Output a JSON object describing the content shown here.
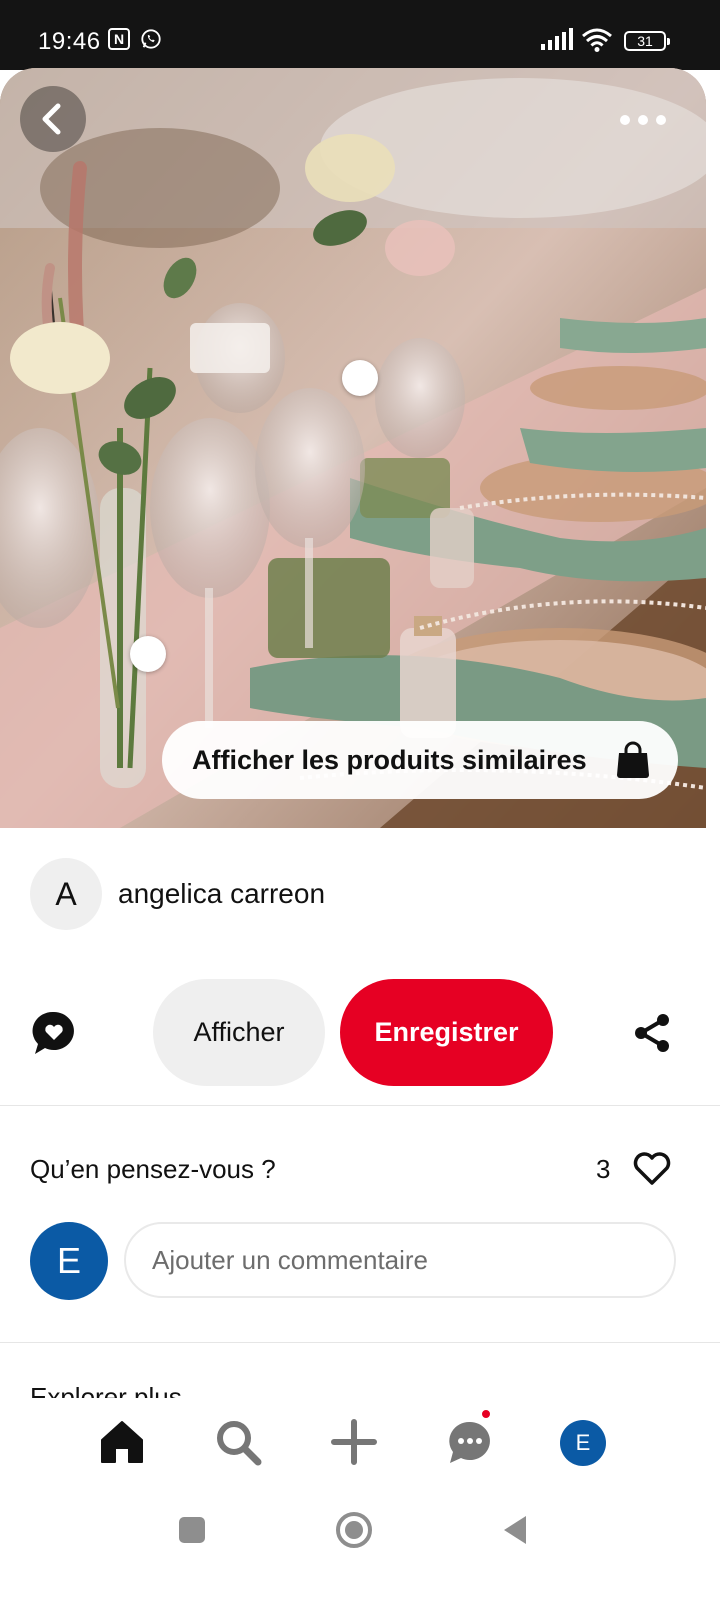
{
  "status_bar": {
    "time": "19:46",
    "nfc_label": "N",
    "battery": "31",
    "icons": [
      "nfc-icon",
      "whatsapp-icon",
      "signal-icon",
      "wifi-icon",
      "battery-icon"
    ]
  },
  "pin": {
    "similar_products_label": "Afficher les produits similaires",
    "hero_icons": [
      "back-arrow-icon",
      "more-options-icon",
      "shopping-bag-icon"
    ]
  },
  "author": {
    "initial": "A",
    "name": "angelica carreon"
  },
  "actions": {
    "view_label": "Afficher",
    "save_label": "Enregistrer",
    "icons": [
      "comment-heart-icon",
      "share-icon"
    ],
    "save_color": "#e60023"
  },
  "comments": {
    "title": "Qu’en pensez-vous ?",
    "reaction_count": "3",
    "user_initial": "E",
    "placeholder": "Ajouter un commentaire"
  },
  "peek": {
    "text": "Explorer plus"
  },
  "bottom_nav": {
    "items": [
      "home-icon",
      "search-icon",
      "plus-icon",
      "messages-icon",
      "profile-avatar"
    ],
    "profile_initial": "E",
    "profile_color": "#0b5aa5"
  },
  "system_nav": {
    "items": [
      "recents-icon",
      "home-circle-icon",
      "back-triangle-icon"
    ]
  }
}
